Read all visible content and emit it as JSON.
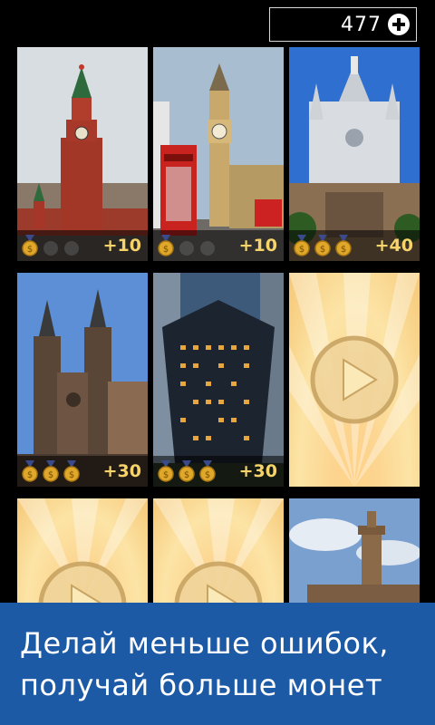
{
  "header": {
    "coin_count": "477",
    "add_icon": "plus-circle-icon"
  },
  "tiles": [
    {
      "id": "moscow",
      "scene": "kremlin-spasskaya-tower",
      "medals_earned": 1,
      "medals_total": 3,
      "reward": "+10",
      "state": "solved"
    },
    {
      "id": "london",
      "scene": "big-ben-phone-booth",
      "medals_earned": 1,
      "medals_total": 3,
      "reward": "+10",
      "state": "solved"
    },
    {
      "id": "barcelona",
      "scene": "tibidabo-church",
      "medals_earned": 3,
      "medals_total": 3,
      "reward": "+40",
      "state": "solved"
    },
    {
      "id": "amsterdam",
      "scene": "st-nicholas-church",
      "medals_earned": 3,
      "medals_total": 3,
      "reward": "+30",
      "state": "solved"
    },
    {
      "id": "glass-building",
      "scene": "glass-skyscraper-night",
      "medals_earned": 3,
      "medals_total": 3,
      "reward": "+30",
      "state": "solved"
    },
    {
      "id": "locked-1",
      "state": "locked",
      "play_icon": "play-icon"
    },
    {
      "id": "locked-2",
      "state": "locked",
      "play_icon": "play-icon"
    },
    {
      "id": "locked-3",
      "state": "locked",
      "play_icon": "play-icon"
    },
    {
      "id": "florence",
      "scene": "palazzo-vecchio-tower",
      "state": "partial"
    }
  ],
  "banner": {
    "line1": "Делай меньше ошибок,",
    "line2": "получай больше монет"
  },
  "colors": {
    "banner_bg": "#1d5aa6",
    "reward_text": "#f6d46a",
    "medal_gold": "#e0a82a",
    "medal_inactive": "#6b6b6b",
    "locked_bg": "#fcd590"
  }
}
